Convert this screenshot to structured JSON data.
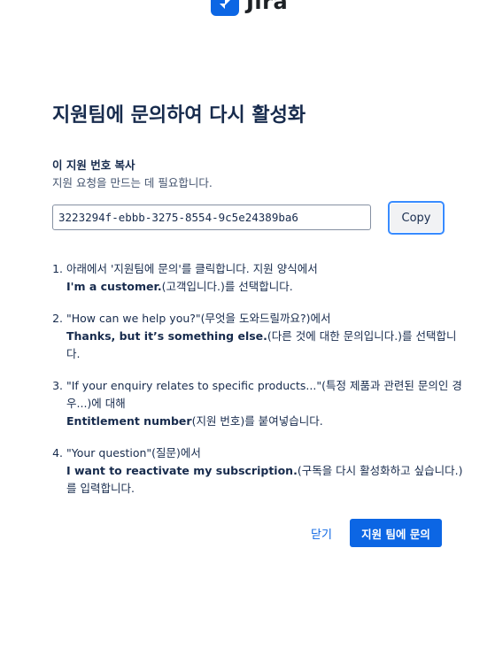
{
  "app": {
    "logo_text": "Jira"
  },
  "dialog": {
    "title": "지원팀에 문의하여 다시 활성화",
    "id_section": {
      "label": "이 지원 번호 복사",
      "sub": "지원 요청을 만드는 데 필요합니다.",
      "value": "3223294f-ebbb-3275-8554-9c5e24389ba6",
      "copy_label": "Copy"
    },
    "steps": [
      {
        "line": "아래에서 '지원팀에 문의'를 클릭합니다. 지원 양식에서",
        "bold": "I'm a customer.",
        "after": "(고객입니다.)를 선택합니다."
      },
      {
        "line": "\"How can we help you?\"(무엇을 도와드릴까요?)에서",
        "bold": "Thanks, but it’s something else.",
        "after": "(다른 것에 대한 문의입니다.)를 선택합니다."
      },
      {
        "line": "\"If your enquiry relates to specific products...\"(특정 제품과 관련된 문의인 경우...)에 대해",
        "bold": "Entitlement number",
        "after": "(지원 번호)를 붙여넣습니다."
      },
      {
        "line": "\"Your question\"(질문)에서",
        "bold": "I want to reactivate my subscription.",
        "after": "(구독을 다시 활성화하고 싶습니다.)를 입력합니다."
      }
    ],
    "close_label": "닫기",
    "contact_label": "지원 팀에 문의"
  },
  "colors": {
    "primary": "#0C66E4",
    "text": "#172B4D"
  }
}
